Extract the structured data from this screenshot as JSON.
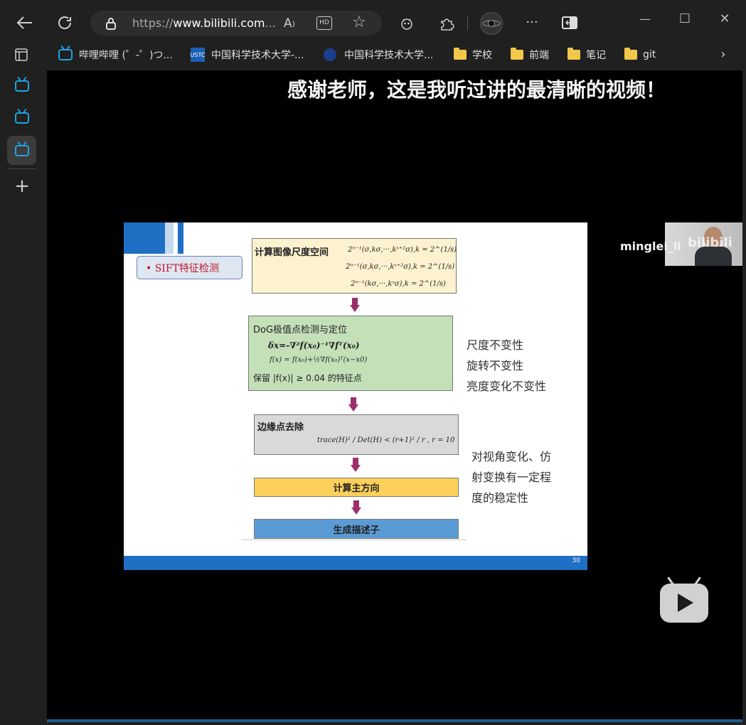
{
  "browser": {
    "address": {
      "prefix": "https://",
      "domain": "www.bilibili.com",
      "suffix": "..."
    },
    "icons": [
      "back-icon",
      "refresh-icon",
      "lock-icon",
      "read-aloud-icon",
      "hd-icon",
      "favorite-star-icon",
      "extension-icon",
      "puzzle-icon",
      "profile-icon",
      "more-icon",
      "split-screen-icon"
    ],
    "window_controls": {
      "minimize": "—",
      "maximize": "☐",
      "close": "✕"
    }
  },
  "favorites": [
    {
      "label": "哔哩哔哩 (゜-゜)つ...",
      "icon": "bilibili-icon"
    },
    {
      "label": "中国科学技术大学-...",
      "icon": "ustc-icon"
    },
    {
      "label": "中国科学技术大学...",
      "icon": "ustc-globe-icon"
    },
    {
      "label": "学校",
      "icon": "folder-icon"
    },
    {
      "label": "前端",
      "icon": "folder-icon"
    },
    {
      "label": "笔记",
      "icon": "folder-icon"
    },
    {
      "label": "git",
      "icon": "folder-icon"
    }
  ],
  "video": {
    "danmaku": "感谢老师，这是我听过讲的最清晰的视频！",
    "uploader": "minglei_li",
    "watermark": "bilibili"
  },
  "slide": {
    "section_label": "• SIFT特征检测",
    "step1_title": "计算图像尺度空间",
    "step1_f1": "2ⁿ⁻¹(σ,kσ,···,kˢ⁺²σ),k = 2^(1/s)",
    "step1_f2": "2ⁿ⁻¹(σ,kσ,···,kˢ⁺²σ),k = 2^(1/s)",
    "step1_f3": "2ⁿ⁻¹(kσ,···,kˢσ),k = 2^(1/s)",
    "step2_title": "DoG极值点检测与定位",
    "step2_f1": "δx=-∇²f(x₀)⁻¹∇fᵀ(x₀)",
    "step2_f2": "f(x) = f(x₀)+½∇f(x₀)ᵀ(x−x0)",
    "step2_f3": "保留 |f(x)| ≥ 0.04 的特征点",
    "step3_title": "边缘点去除",
    "step3_f1": "trace(H)² / Det(H) < (r+1)² / r , r = 10",
    "step4_title": "计算主方向",
    "step5_title": "生成描述子",
    "note1": [
      "尺度不变性",
      "旋转不变性",
      "亮度变化不变性"
    ],
    "note2": [
      "对视角变化、仿",
      "射变换有一定程",
      "度的稳定性"
    ],
    "page_number": "30"
  }
}
